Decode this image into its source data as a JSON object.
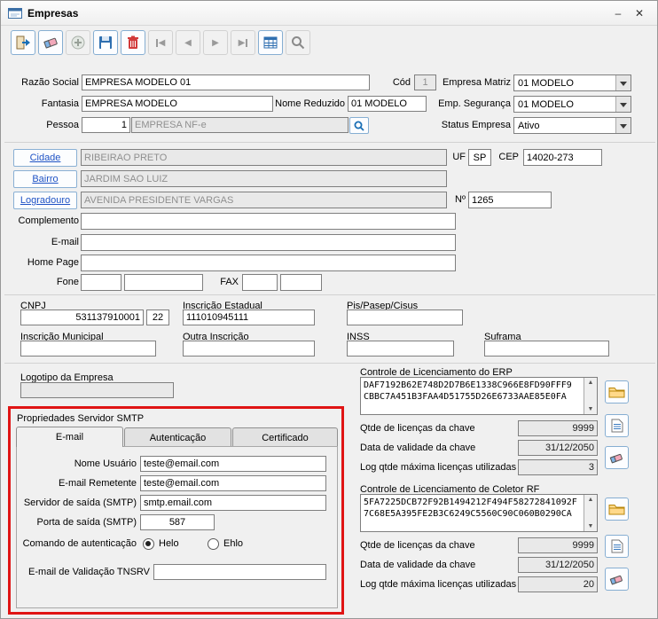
{
  "window": {
    "title": "Empresas",
    "minimize_glyph": "–",
    "close_glyph": "✕"
  },
  "icons": {
    "scroll_up_glyph": "▲",
    "scroll_down_glyph": "▼",
    "nav_first_glyph": "◀",
    "nav_prev_glyph": "◀",
    "nav_next_glyph": "▶",
    "nav_last_glyph": "▶"
  },
  "colors": {
    "annotation_red": "#e01414",
    "toolbar_border_blue": "#86aed2",
    "link_blue": "#1f53c5",
    "readonly_bg": "#e9e9e9"
  },
  "toolbar": {
    "buttons": [
      {
        "name": "exit",
        "enabled": true
      },
      {
        "name": "clear",
        "enabled": true
      },
      {
        "name": "add",
        "enabled": false
      },
      {
        "name": "save",
        "enabled": true
      },
      {
        "name": "delete",
        "enabled": true
      },
      {
        "name": "first",
        "enabled": false
      },
      {
        "name": "previous",
        "enabled": false
      },
      {
        "name": "next",
        "enabled": false
      },
      {
        "name": "last",
        "enabled": false
      },
      {
        "name": "grid",
        "enabled": true
      },
      {
        "name": "search",
        "enabled": false
      }
    ]
  },
  "general": {
    "razao_social": {
      "label": "Razão Social",
      "value": "EMPRESA MODELO 01"
    },
    "cod": {
      "label": "Cód",
      "value": "1"
    },
    "empresa_matriz": {
      "label": "Empresa Matriz",
      "value": "01 MODELO"
    },
    "fantasia": {
      "label": "Fantasia",
      "value": "EMPRESA MODELO"
    },
    "nome_reduzido": {
      "label": "Nome Reduzido",
      "value": "01 MODELO"
    },
    "emp_seguranca": {
      "label": "Emp. Segurança",
      "value": "01 MODELO"
    },
    "pessoa": {
      "label": "Pessoa",
      "code": "1",
      "name": "EMPRESA NF-e"
    },
    "status_empresa": {
      "label": "Status Empresa",
      "value": "Ativo"
    }
  },
  "address": {
    "cidade": {
      "label": "Cidade",
      "value": "RIBEIRAO PRETO"
    },
    "uf": {
      "label": "UF",
      "value": "SP"
    },
    "cep": {
      "label": "CEP",
      "value": "14020-273"
    },
    "bairro": {
      "label": "Bairro",
      "value": "JARDIM SAO LUIZ"
    },
    "logradouro": {
      "label": "Logradouro",
      "value": "AVENIDA PRESIDENTE VARGAS"
    },
    "numero": {
      "label": "Nº",
      "value": "1265"
    },
    "complemento": {
      "label": "Complemento",
      "value": ""
    },
    "email": {
      "label": "E-mail",
      "value": ""
    },
    "home_page": {
      "label": "Home Page",
      "value": ""
    },
    "fone": {
      "label": "Fone",
      "ddd": "",
      "numero": ""
    },
    "fax": {
      "label": "FAX",
      "ddd": "",
      "numero": ""
    }
  },
  "fiscal": {
    "cnpj": {
      "label": "CNPJ",
      "value": "531137910001",
      "digito": "22"
    },
    "inscricao_estadual": {
      "label": "Inscrição Estadual",
      "value": "111010945111"
    },
    "pis": {
      "label": "Pis/Pasep/Cisus",
      "value": ""
    },
    "inscricao_municipal": {
      "label": "Inscrição Municipal",
      "value": ""
    },
    "outra_inscricao": {
      "label": "Outra Inscrição",
      "value": ""
    },
    "inss": {
      "label": "INSS",
      "value": ""
    },
    "suframa": {
      "label": "Suframa",
      "value": ""
    }
  },
  "logotipo": {
    "label": "Logotipo da Empresa",
    "value": ""
  },
  "smtp": {
    "group_label": "Propriedades Servidor SMTP",
    "tabs": [
      "E-mail",
      "Autenticação",
      "Certificado"
    ],
    "active_tab": "E-mail",
    "nome_usuario": {
      "label": "Nome Usuário",
      "value": "teste@email.com"
    },
    "email_remetente": {
      "label": "E-mail Remetente",
      "value": "teste@email.com"
    },
    "servidor_saida": {
      "label": "Servidor de saída (SMTP)",
      "value": "smtp.email.com"
    },
    "porta_saida": {
      "label": "Porta de saída (SMTP)",
      "value": "587"
    },
    "comando_autenticacao": {
      "label": "Comando de autenticação",
      "options": [
        "Helo",
        "Ehlo"
      ],
      "selected": "Helo"
    },
    "email_validacao": {
      "label": "E-mail de Validação TNSRV",
      "value": ""
    }
  },
  "erp_license": {
    "title": "Controle de Licenciamento do ERP",
    "key_line1": "DAF7192B62E748D2D7B6E1338C966E8FD90FFF9",
    "key_line2": "CBBC7A451B3FAA4D51755D26E6733AAE85E0FA",
    "qtde": {
      "label": "Qtde de licenças da chave",
      "value": "9999"
    },
    "validade": {
      "label": "Data de validade da chave",
      "value": "31/12/2050"
    },
    "log": {
      "label": "Log qtde máxima licenças utilizadas",
      "value": "3"
    }
  },
  "rf_license": {
    "title": "Controle de Licenciamento de Coletor RF",
    "key_line1": "5FA7225DCB72F92B1494212F494F58272841092F",
    "key_line2": "7C68E5A395FE2B3C6249C5560C90C060B0290CA",
    "qtde": {
      "label": "Qtde de licenças da chave",
      "value": "9999"
    },
    "validade": {
      "label": "Data de validade da chave",
      "value": "31/12/2050"
    },
    "log": {
      "label": "Log qtde máxima licenças utilizadas",
      "value": "20"
    }
  }
}
